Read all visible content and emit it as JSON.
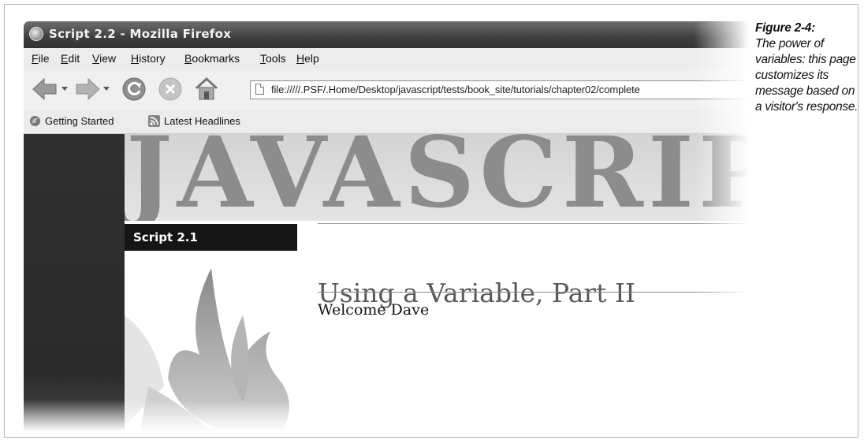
{
  "window": {
    "title": "Script 2.2 - Mozilla Firefox"
  },
  "menubar": {
    "items": [
      "File",
      "Edit",
      "View",
      "History",
      "Bookmarks",
      "Tools",
      "Help"
    ]
  },
  "navbar": {
    "back_icon": "back-arrow-icon",
    "forward_icon": "forward-arrow-icon",
    "reload_icon": "reload-icon",
    "stop_icon": "stop-icon",
    "home_icon": "home-icon",
    "url": "file://///.PSF/.Home/Desktop/javascript/tests/book_site/tutorials/chapter02/complete"
  },
  "bookmarks": {
    "items": [
      {
        "label": "Getting Started",
        "icon": "firefox-icon"
      },
      {
        "label": "Latest Headlines",
        "icon": "rss-feed-icon"
      }
    ]
  },
  "page": {
    "banner": "JAVASCRIPT",
    "script_label": "Script 2.1",
    "heading": "Using a Variable, Part II",
    "welcome": "Welcome Dave"
  },
  "caption": {
    "figure": "Figure 2-4:",
    "text": "The power of variables: this page customizes its message based on a visitor's response."
  }
}
